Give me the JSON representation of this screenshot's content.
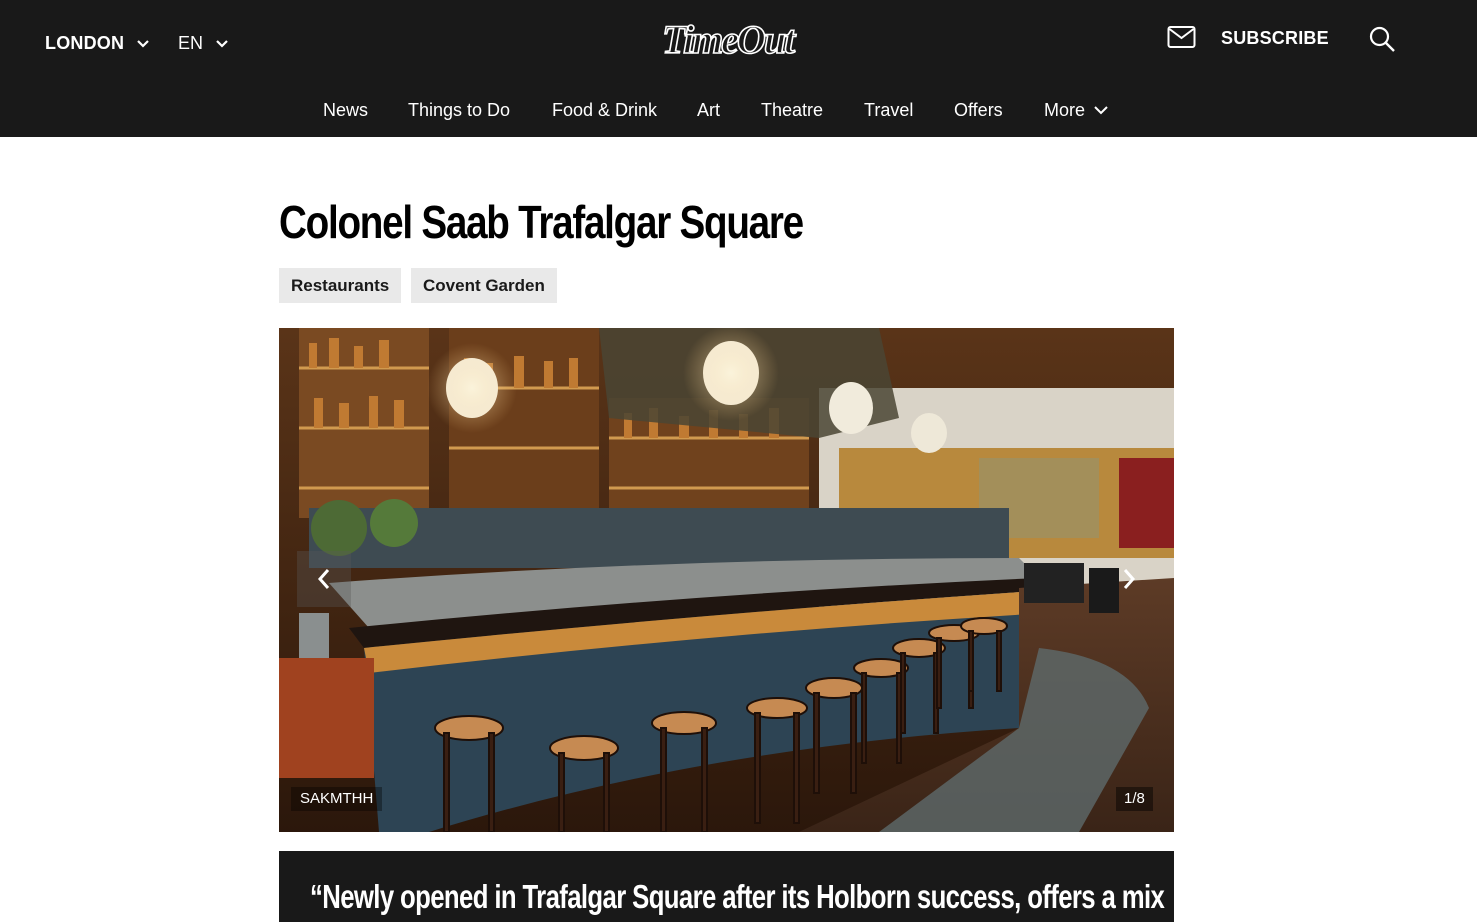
{
  "header": {
    "location": "LONDON",
    "language": "EN",
    "logo": "TimeOut",
    "subscribe_label": "SUBSCRIBE",
    "icons": {
      "mail": "mail-icon",
      "search": "search-icon",
      "chevron": "chevron-down-icon"
    }
  },
  "nav": {
    "items": [
      "News",
      "Things to Do",
      "Food & Drink",
      "Art",
      "Theatre",
      "Travel",
      "Offers",
      "More"
    ]
  },
  "article": {
    "title": "Colonel Saab Trafalgar Square",
    "tags": [
      "Restaurants",
      "Covent Garden"
    ],
    "gallery": {
      "credit": "SAKMTHH",
      "counter": "1/8",
      "icons": {
        "prev": "chevron-left-icon",
        "next": "chevron-right-icon"
      }
    },
    "quote": "“Newly opened in Trafalgar Square after its Holborn success, offers a mix"
  },
  "colors": {
    "header_bg": "#191919",
    "tag_bg": "#e9e9e9",
    "text": "#000000"
  }
}
